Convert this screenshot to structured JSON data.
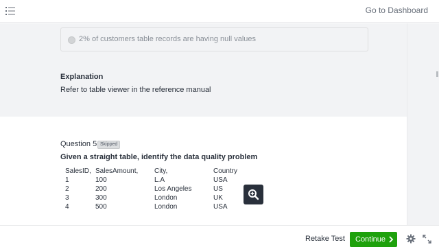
{
  "header": {
    "dashboard_link": "Go to Dashboard"
  },
  "previous_question": {
    "answer_option": "2% of customers table records are having null values",
    "explanation_title": "Explanation",
    "explanation_text": "Refer to table viewer in the reference manual"
  },
  "question": {
    "label": "Question 5:",
    "status_badge": "Skipped",
    "text": "Given a straight table, identify the data quality problem",
    "table": {
      "headers": [
        "SalesID,",
        "SalesAmount,",
        "City,",
        "Country"
      ],
      "rows": [
        [
          "1",
          "100",
          "L.A",
          "USA"
        ],
        [
          "2",
          "200",
          "Los Angeles",
          "US"
        ],
        [
          "3",
          "300",
          "London",
          "UK"
        ],
        [
          "4",
          "500",
          "London",
          "USA"
        ]
      ]
    }
  },
  "footer": {
    "retake_label": "Retake Test",
    "continue_label": "Continue"
  },
  "icons": {
    "menu": "list-menu-icon",
    "zoom": "zoom-in-icon",
    "settings": "gear-icon",
    "fullscreen": "expand-icon"
  },
  "colors": {
    "primary_action": "#1ea10c",
    "zoom_button": "#29303b",
    "muted_panel": "#f2f3f5"
  }
}
